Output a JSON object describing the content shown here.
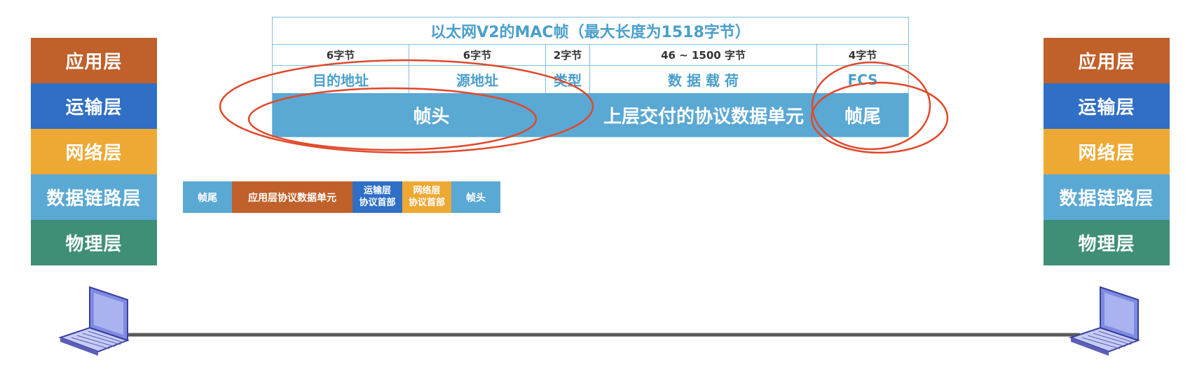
{
  "left_stack": [
    "应用层",
    "运输层",
    "网络层",
    "数据链路层",
    "物理层"
  ],
  "right_stack": [
    "应用层",
    "运输层",
    "网络层",
    "数据链路层",
    "物理层"
  ],
  "frame": {
    "title": "以太网V2的MAC帧（最大长度为1518字节）",
    "sizes": [
      "6字节",
      "6字节",
      "2字节",
      "46 ~ 1500 字节",
      "4字节"
    ],
    "fields": [
      "目的地址",
      "源地址",
      "类型",
      "数 据 载 荷",
      "FCS"
    ],
    "bar": {
      "head": "帧头",
      "payload": "上层交付的协议数据单元",
      "tail": "帧尾"
    }
  },
  "packet": {
    "tail": "帧尾",
    "app": "应用层协议数据单元",
    "trans_line1": "运输层",
    "trans_line2": "协议首部",
    "net_line1": "网络层",
    "net_line2": "协议首部",
    "head": "帧头"
  },
  "colors": {
    "app": "#c0602a",
    "transport": "#2f6fc5",
    "network": "#eea934",
    "datalink": "#5aa8d4",
    "physical": "#3f8f78",
    "highlight": "#e0482a"
  },
  "icons": [
    "laptop-icon",
    "laptop-icon"
  ]
}
